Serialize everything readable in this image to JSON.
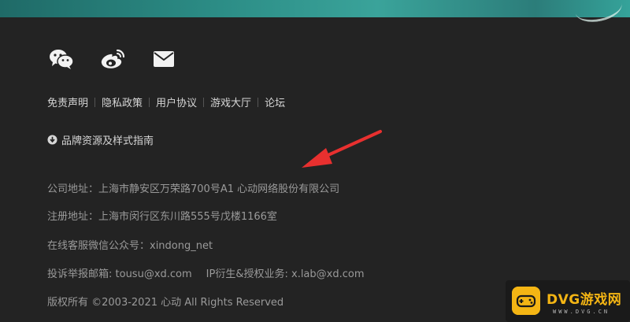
{
  "social": {
    "icons": [
      "wechat-icon",
      "weibo-icon",
      "mail-icon"
    ]
  },
  "footer_links": [
    {
      "label": "免责声明"
    },
    {
      "label": "隐私政策"
    },
    {
      "label": "用户协议"
    },
    {
      "label": "游戏大厅"
    },
    {
      "label": "论坛"
    }
  ],
  "brand_guide": {
    "label": "品牌资源及样式指南",
    "icon": "download-icon"
  },
  "company_info": {
    "address": "公司地址：上海市静安区万荣路700号A1 心动网络股份有限公司",
    "registered_address": "注册地址：上海市闵行区东川路555号戊楼1166室",
    "service_wechat": "在线客服微信公众号：xindong_net",
    "report_email": "投诉举报邮箱: tousu@xd.com",
    "ip_email": "IP衍生&授权业务: x.lab@xd.com",
    "copyright": "版权所有 ©2003-2021 心动 All Rights Reserved"
  },
  "watermark": {
    "title": "DVG游戏网",
    "url": "WWW.DVG.CN"
  },
  "colors": {
    "background": "#232323",
    "link_text": "#d6d6d6",
    "info_text": "#9a9a9a",
    "arrow": "#e8302f",
    "watermark_accent": "#f4b514"
  }
}
